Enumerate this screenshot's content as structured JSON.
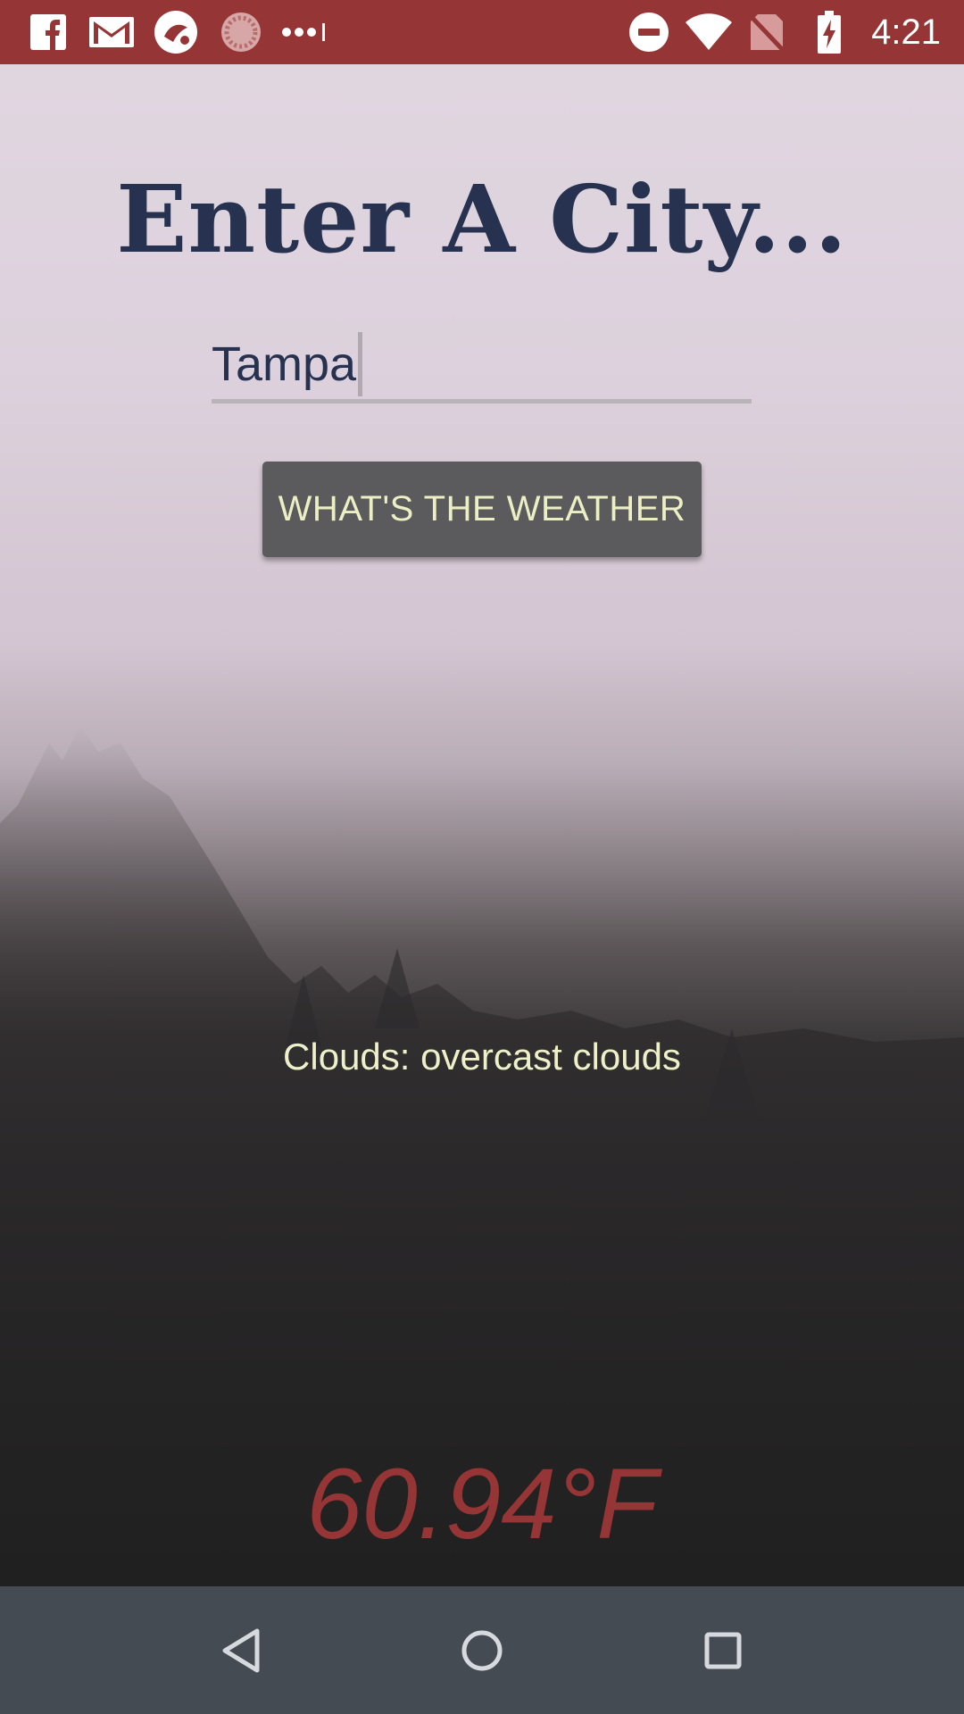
{
  "status_bar": {
    "time": "4:21",
    "background_color": "#963535",
    "left_icons": [
      "facebook-icon",
      "gmail-icon",
      "app-icon",
      "loading-icon",
      "more-icon"
    ],
    "right_icons": [
      "do-not-disturb-icon",
      "wifi-icon",
      "no-sim-icon",
      "battery-charging-icon"
    ]
  },
  "app": {
    "title": "Enter A City...",
    "city_input": {
      "value": "Tampa"
    },
    "weather_button_label": "WHAT'S THE WEATHER",
    "description": "Clouds: overcast clouds",
    "temperature": "60.94°F",
    "colors": {
      "title": "#273150",
      "button_bg": "#5b5a5c",
      "button_text": "#ecefc4",
      "temperature": "#963535"
    }
  },
  "nav_bar": {
    "buttons": [
      "back-icon",
      "home-icon",
      "recents-icon"
    ]
  }
}
